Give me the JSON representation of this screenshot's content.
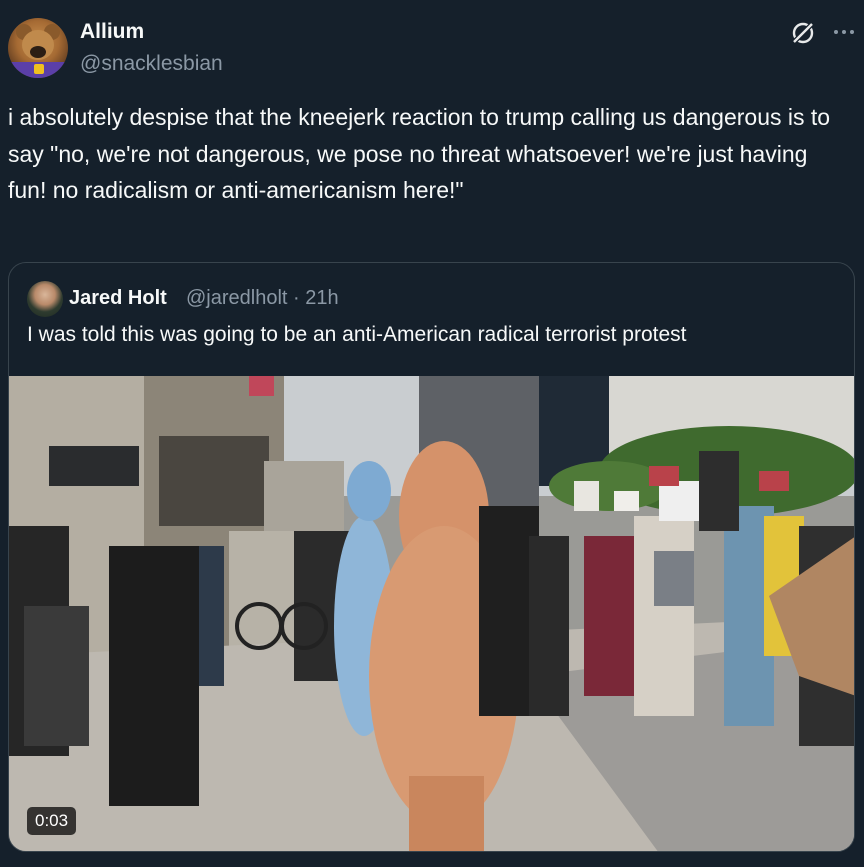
{
  "post": {
    "display_name": "Allium",
    "handle": "@snacklesbian",
    "text": "i absolutely despise that the kneejerk reaction to trump calling us dangerous is to say \"no, we're not dangerous, we pose no threat whatsoever! we're just having fun! no radicalism or anti-americanism here!\""
  },
  "quoted": {
    "display_name": "Jared Holt",
    "handle_time": "@jaredlholt · 21h",
    "text": "I was told this was going to be an anti-American radical terrorist protest",
    "video_duration": "0:03"
  },
  "icons": {
    "grok": "grok-icon",
    "more": "more-horizontal-icon"
  },
  "colors": {
    "background": "#15202b",
    "primary_text": "#f7f9f9",
    "secondary_text": "#8b98a5",
    "border": "#38444d"
  }
}
